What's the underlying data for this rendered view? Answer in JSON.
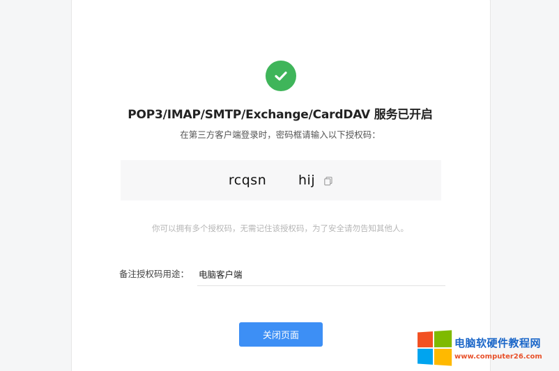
{
  "header": {
    "title": "POP3/IMAP/SMTP/Exchange/CardDAV 服务已开启",
    "subtitle": "在第三方客户端登录时，密码框请输入以下授权码："
  },
  "auth_code": {
    "value": "rcqsn       hij"
  },
  "note": "你可以拥有多个授权码，无需记住该授权码，为了安全请勿告知其他人。",
  "remark": {
    "label": "备注授权码用途：",
    "value": "电脑客户端"
  },
  "buttons": {
    "close_label": "关闭页面"
  },
  "watermark": {
    "title": "电脑软硬件教程网",
    "url": "www.computer26.com"
  },
  "colors": {
    "success": "#3fb55a",
    "primary": "#3d8ff5",
    "win_red": "#f25022",
    "win_green": "#7fba00",
    "win_blue": "#00a4ef",
    "win_yellow": "#ffb900"
  },
  "icons": {
    "success": "check-circle-icon",
    "copy": "copy-icon"
  }
}
